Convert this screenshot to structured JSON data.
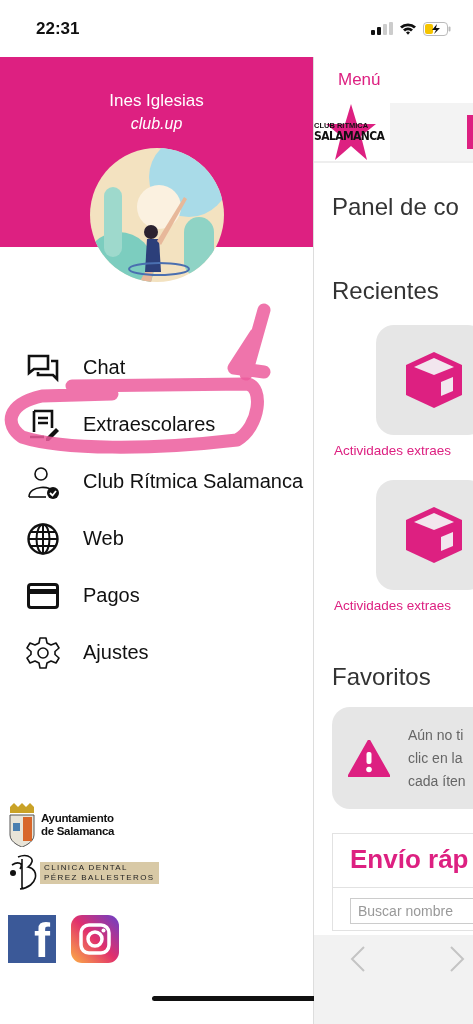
{
  "status_bar": {
    "time": "22:31"
  },
  "drawer": {
    "user_name": "Ines Iglesias",
    "subtitle": "club.up",
    "menu": [
      {
        "kind": "chat",
        "label": "Chat"
      },
      {
        "kind": "form",
        "label": "Extraescolares"
      },
      {
        "kind": "member",
        "label": "Club Rítmica Salamanca"
      },
      {
        "kind": "globe",
        "label": "Web"
      },
      {
        "kind": "card",
        "label": "Pagos"
      },
      {
        "kind": "gear",
        "label": "Ajustes"
      }
    ],
    "sponsors": [
      {
        "kind": "city",
        "lines": [
          "Ayuntamiento",
          "de Salamanca"
        ]
      },
      {
        "kind": "clinic",
        "lines": [
          "CLINICA DENTAL",
          "PÉREZ BALLESTEROS"
        ]
      }
    ],
    "social": [
      {
        "kind": "facebook",
        "glyph": "f"
      },
      {
        "kind": "instagram"
      }
    ]
  },
  "main": {
    "back_label": "Menú",
    "logo": {
      "lines": [
        "CLUB RITMICA",
        "SALAMANCA"
      ]
    },
    "title": "Panel de co",
    "recent_title": "Recientes",
    "recent": [
      {
        "caption": "Actividades extraes"
      },
      {
        "caption": "Actividades extraes"
      }
    ],
    "favorites_title": "Favoritos",
    "favorites_notice": [
      "Aún no ti",
      "clic en la",
      "cada íten"
    ],
    "quick_send": {
      "title": "Envío ráp",
      "search_placeholder": "Buscar nombre"
    }
  }
}
